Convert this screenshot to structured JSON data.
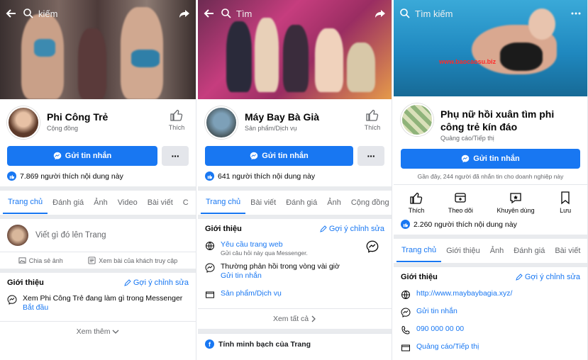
{
  "panel1": {
    "search_text": "kiếm",
    "page_name": "Phi Công Trẻ",
    "category": "Cộng đồng",
    "like_label": "Thích",
    "message_button": "Gửi tin nhắn",
    "more_button": "···",
    "likes_text": "7.869 người thích nội dung này",
    "tabs": [
      "Trang chủ",
      "Đánh giá",
      "Ảnh",
      "Video",
      "Bài viết",
      "C"
    ],
    "compose_placeholder": "Viết gì đó lên Trang",
    "share_photo": "Chia sẻ ảnh",
    "visitor_posts": "Xem bài của khách truy cập",
    "intro_title": "Giới thiệu",
    "suggest_edit": "Gợi ý chỉnh sửa",
    "messenger_line": "Xem Phi Công Trẻ đang làm gì trong Messenger",
    "start_link": "Bắt đầu",
    "see_more": "Xem thêm"
  },
  "panel2": {
    "search_text": "Tìm",
    "page_name": "Máy Bay Bà Già",
    "category": "Sản phẩm/Dịch vụ",
    "like_label": "Thích",
    "message_button": "Gửi tin nhắn",
    "more_button": "···",
    "likes_text": "641 người thích nội dung này",
    "tabs": [
      "Trang chủ",
      "Bài viết",
      "Đánh giá",
      "Ảnh",
      "Cộng đồng"
    ],
    "intro_title": "Giới thiệu",
    "suggest_edit": "Gợi ý chỉnh sửa",
    "web_request": "Yêu cầu trang web",
    "web_request_sub": "Gửi câu hỏi này qua Messenger.",
    "reply_line": "Thường phản hồi trong vòng vài giờ",
    "send_message_link": "Gửi tin nhắn",
    "product_link": "Sản phẩm/Dịch vụ",
    "see_all": "Xem tất cả",
    "transparency": "Tính minh bạch của Trang"
  },
  "panel3": {
    "search_text": "Tìm kiếm",
    "watermark": "www.baocaosu.biz",
    "page_name": "Phụ nữ hồi xuân tìm phi công trẻ kín đáo",
    "category": "Quảng cáo/Tiếp thị",
    "message_button": "Gửi tin nhắn",
    "recent_note": "Gần đây, 244 người đã nhắn tin cho doanh nghiệp này",
    "actions": [
      "Thích",
      "Theo dõi",
      "Khuyên dùng",
      "Lưu"
    ],
    "likes_text": "2.260 người thích nội dung này",
    "tabs": [
      "Trang chủ",
      "Giới thiệu",
      "Ảnh",
      "Đánh giá",
      "Bài viết"
    ],
    "intro_title": "Giới thiệu",
    "suggest_edit": "Gợi ý chỉnh sửa",
    "website": "http://www.maybaybagia.xyz/",
    "send_message": "Gửi tin nhắn",
    "phone": "090 000 00 00",
    "category_link": "Quảng cáo/Tiếp thị"
  },
  "colors": {
    "brand": "#1877f2",
    "muted": "#65676b",
    "divider": "#e9ebee"
  }
}
